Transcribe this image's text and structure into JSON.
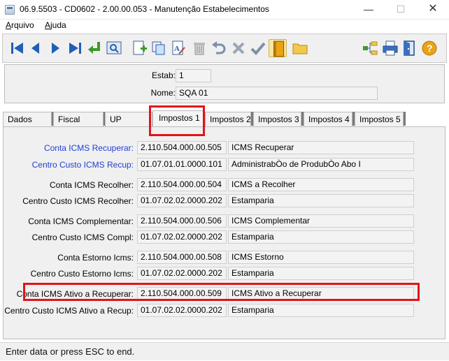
{
  "window": {
    "title": "06.9.5503 - CD0602 - 2.00.00.053 - Manutenção Estabelecimentos",
    "min_glyph": "—",
    "max_glyph": "☐",
    "close_glyph": "✕"
  },
  "menu": {
    "items": [
      {
        "label_first": "A",
        "label_rest": "rquivo"
      },
      {
        "label_first": "A",
        "label_rest": "juda"
      }
    ]
  },
  "toolbar": {
    "icons": [
      "first-record-icon",
      "previous-record-icon",
      "next-record-icon",
      "last-record-icon",
      "goto-record-icon",
      "search-icon",
      "new-record-icon",
      "copy-record-icon",
      "edit-record-icon",
      "delete-record-icon",
      "undo-icon",
      "cancel-icon",
      "confirm-icon",
      "notebook-icon",
      "folder-icon",
      "tree-icon",
      "print-icon",
      "exit-icon",
      "help-icon"
    ]
  },
  "header": {
    "estab_label": "Estab:",
    "estab_value": "1",
    "nome_label": "Nome:",
    "nome_value": "SQA 01"
  },
  "tabs": [
    {
      "label": "Dados"
    },
    {
      "label": "Fiscal"
    },
    {
      "label": "UP"
    },
    {
      "label": "Impostos 1"
    },
    {
      "label": "Impostos 2"
    },
    {
      "label": "Impostos 3"
    },
    {
      "label": "Impostos 4"
    },
    {
      "label": "Impostos 5"
    }
  ],
  "rows": [
    {
      "label": "Conta ICMS Recuperar:",
      "code": "2.110.504.000.00.505",
      "desc": "ICMS Recuperar"
    },
    {
      "label": "Centro Custo ICMS Recup:",
      "code": "01.07.01.01.0000.101",
      "desc": "AdministrabÒo de ProdubÒo Abo I"
    },
    {
      "label": "Conta ICMS Recolher:",
      "code": "2.110.504.000.00.504",
      "desc": "ICMS a Recolher"
    },
    {
      "label": "Centro Custo ICMS Recolher:",
      "code": "01.07.02.02.0000.202",
      "desc": "Estamparia"
    },
    {
      "label": "Conta ICMS Complementar:",
      "code": "2.110.504.000.00.506",
      "desc": "ICMS Complementar"
    },
    {
      "label": "Centro Custo ICMS Compl:",
      "code": "01.07.02.02.0000.202",
      "desc": "Estamparia"
    },
    {
      "label": "Conta Estorno Icms:",
      "code": "2.110.504.000.00.508",
      "desc": "ICMS Estorno"
    },
    {
      "label": "Centro Custo Estorno Icms:",
      "code": "01.07.02.02.0000.202",
      "desc": "Estamparia"
    },
    {
      "label": "Conta ICMS Ativo a Recuperar:",
      "code": "2.110.504.000.00.509",
      "desc": "ICMS Ativo a Recuperar"
    },
    {
      "label": "Centro Custo ICMS Ativo a Recup:",
      "code": "01.07.02.02.0000.202",
      "desc": "Estamparia"
    }
  ],
  "status": {
    "message": "Enter data or press ESC to end."
  },
  "colors": {
    "link": "#1f3fd1",
    "highlight": "#e0141b",
    "toolbar_blue": "#1f5fb8"
  }
}
